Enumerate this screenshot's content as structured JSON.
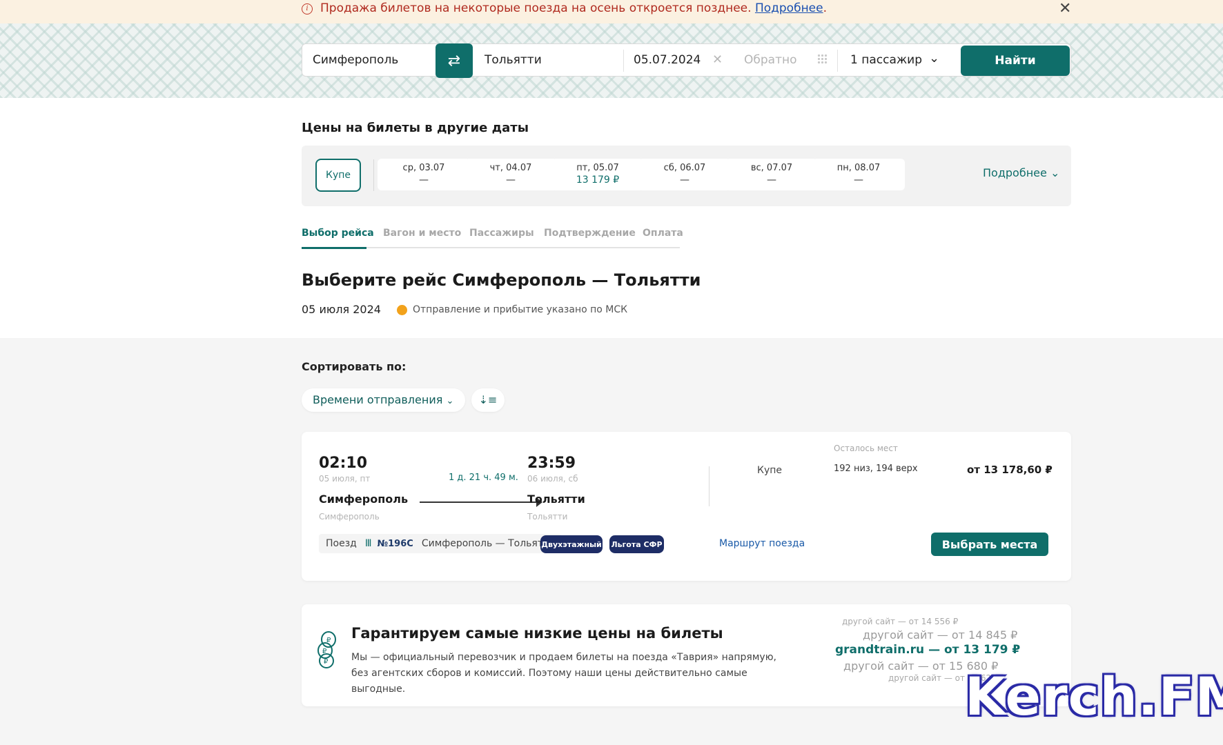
{
  "notice": {
    "text": "Продажа билетов на некоторые поезда на осень откроется позднее.",
    "link": "Подробнее",
    "tail": "."
  },
  "search": {
    "from": "Симферополь",
    "to": "Тольятти",
    "date": "05.07.2024",
    "back_placeholder": "Обратно",
    "passengers": "1 пассажир",
    "find_label": "Найти"
  },
  "other_dates": {
    "title": "Цены на билеты в другие даты",
    "class_chip": "Купе",
    "days": [
      {
        "label": "ср, 03.07",
        "price": "—"
      },
      {
        "label": "чт, 04.07",
        "price": "—"
      },
      {
        "label": "пт, 05.07",
        "price": "13 179 ₽"
      },
      {
        "label": "сб, 06.07",
        "price": "—"
      },
      {
        "label": "вс, 07.07",
        "price": "—"
      },
      {
        "label": "пн, 08.07",
        "price": "—"
      }
    ],
    "more": "Подробнее"
  },
  "steps": [
    "Выбор рейса",
    "Вагон и место",
    "Пассажиры",
    "Подтверждение",
    "Оплата"
  ],
  "heading": {
    "title": "Выберите рейс Симферополь — Тольятти",
    "date": "05 июля 2024",
    "note": "Отправление и прибытие указано по МСК"
  },
  "sort": {
    "label": "Сортировать по:",
    "value": "Времени отправления"
  },
  "train": {
    "dep_time": "02:10",
    "dep_date": "05 июля, пт",
    "duration": "1 д. 21 ч. 49 м.",
    "arr_time": "23:59",
    "arr_date": "06 июля, сб",
    "from_city": "Симферополь",
    "from_station": "Симферополь",
    "to_city": "Тольятти",
    "to_station": "Тольятти",
    "class": "Купе",
    "seats_label": "Осталось мест",
    "seats": "192 низ, 194 верх",
    "price": "от 13 178,60 ₽",
    "type_label": "Поезд",
    "number": "№196С",
    "route": "Симферополь — Тольятти",
    "badge1": "Двухэтажный",
    "badge2": "Льгота СФР",
    "route_link": "Маршрут поезда",
    "select_label": "Выбрать места"
  },
  "guarantee": {
    "title": "Гарантируем самые низкие цены на билеты",
    "line1": "Мы — официальный перевозчик и продаем билеты на поезда «Таврия» напрямую,",
    "line2": "без агентских сборов и комиссий. Поэтому наши цены действительно самые выгодные.",
    "cmp1": "другой сайт — от 14 556 ₽",
    "cmp2": "другой сайт — от 14 845 ₽",
    "cmp3": "grandtrain.ru — от 13 179 ₽",
    "cmp4": "другой сайт — от 15 680 ₽",
    "cmp5": "другой сайт — от 15 628 ₽"
  },
  "watermark": "Kerch.FM",
  "colors": {
    "accent": "#0f6e6a",
    "badge": "#1e2d66",
    "notice_bg": "#fbf1e1",
    "notice_text": "#b02a1f"
  }
}
